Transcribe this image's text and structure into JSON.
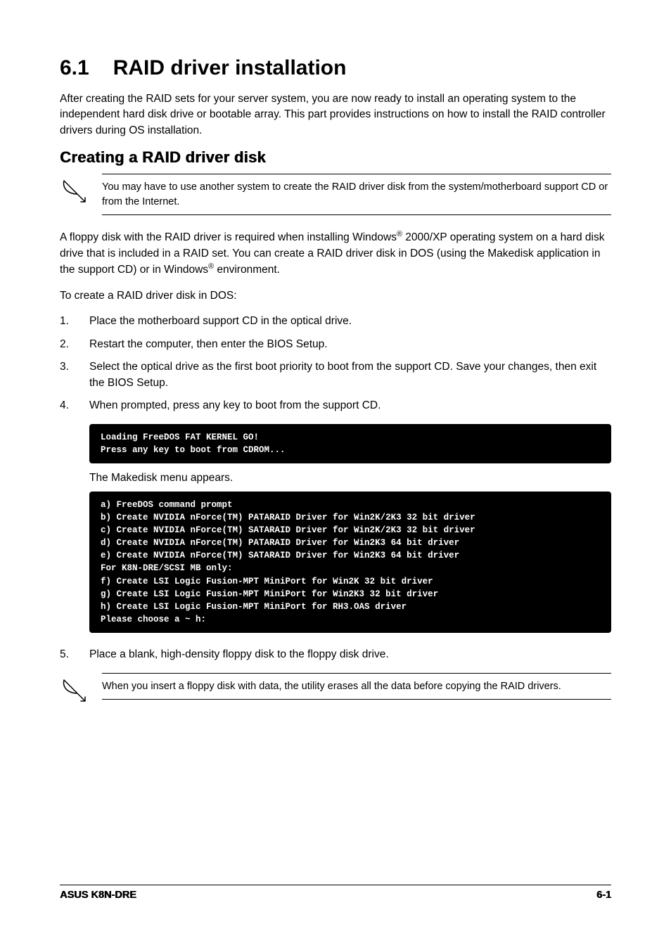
{
  "heading": {
    "number": "6.1",
    "title": "RAID driver installation"
  },
  "intro": "After creating the RAID sets for your server system, you are now ready to install an operating system to the independent hard disk drive or bootable array. This part provides instructions on how to install the RAID controller drivers during OS installation.",
  "section_title": "Creating a RAID driver disk",
  "note1": "You may have to use another system to create the RAID driver disk from the system/motherboard support CD or from the Internet.",
  "para1_a": "A floppy disk with the RAID driver is required when installing Windows",
  "para1_b": " 2000/XP operating system on a hard disk drive that is included in a RAID set. You can create a RAID driver disk in DOS (using the Makedisk application in the support CD) or in Windows",
  "para1_c": " environment.",
  "para2": "To create a RAID driver disk in DOS:",
  "steps": [
    "Place the motherboard support CD in the optical drive.",
    "Restart the computer, then enter the BIOS Setup.",
    "Select the optical drive as the first boot priority to boot from the support CD. Save your changes, then exit the BIOS Setup.",
    "When prompted, press any key to boot from the support CD."
  ],
  "terminal1": "Loading FreeDOS FAT KERNEL GO!\nPress any key to boot from CDROM...",
  "sub_para": "The Makedisk menu appears.",
  "terminal2": "a) FreeDOS command prompt\nb) Create NVIDIA nForce(TM) PATARAID Driver for Win2K/2K3 32 bit driver\nc) Create NVIDIA nForce(TM) SATARAID Driver for Win2K/2K3 32 bit driver\nd) Create NVIDIA nForce(TM) PATARAID Driver for Win2K3 64 bit driver\ne) Create NVIDIA nForce(TM) SATARAID Driver for Win2K3 64 bit driver\nFor K8N-DRE/SCSI MB only:\nf) Create LSI Logic Fusion-MPT MiniPort for Win2K 32 bit driver\ng) Create LSI Logic Fusion-MPT MiniPort for Win2K3 32 bit driver\nh) Create LSI Logic Fusion-MPT MiniPort for RH3.OAS driver\nPlease choose a ~ h:\n",
  "step5": "Place a blank, high-density floppy disk to the floppy disk drive.",
  "note2": "When you insert a floppy disk with data, the utility erases all the data before copying the RAID drivers.",
  "footer": {
    "left": "ASUS K8N-DRE",
    "right": "6-1"
  },
  "reg": "®"
}
